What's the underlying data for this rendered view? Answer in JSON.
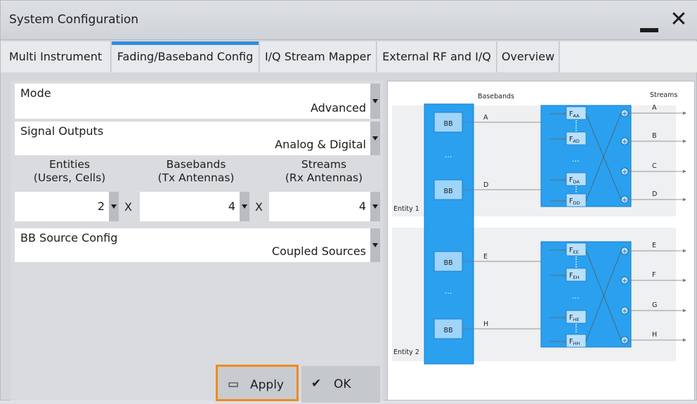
{
  "window": {
    "title": "System Configuration"
  },
  "tabs": [
    {
      "label": "Multi Instrument"
    },
    {
      "label": "Fading/Baseband Config"
    },
    {
      "label": "I/Q Stream Mapper"
    },
    {
      "label": "External RF and I/Q"
    },
    {
      "label": "Overview"
    }
  ],
  "form": {
    "mode": {
      "label": "Mode",
      "value": "Advanced"
    },
    "signal_outputs": {
      "label": "Signal Outputs",
      "value": "Analog & Digital"
    },
    "entities": {
      "label1": "Entities",
      "label2": "(Users, Cells)",
      "value": "2"
    },
    "basebands": {
      "label1": "Basebands",
      "label2": "(Tx Antennas)",
      "value": "4"
    },
    "streams": {
      "label1": "Streams",
      "label2": "(Rx Antennas)",
      "value": "4"
    },
    "x_symbol": "X",
    "bb_source": {
      "label": "BB Source Config",
      "value": "Coupled Sources"
    }
  },
  "buttons": {
    "apply": "Apply",
    "ok": "OK"
  },
  "diagram": {
    "basebands_label": "Basebands",
    "streams_label": "Streams",
    "bb_label": "BB",
    "ellipsis": "...",
    "entity1_label": "Entity 1",
    "entity2_label": "Entity 2",
    "entity1_bb": [
      "A",
      "D"
    ],
    "entity2_bb": [
      "E",
      "H"
    ],
    "entity1_streams": [
      "A",
      "B",
      "C",
      "D"
    ],
    "entity2_streams": [
      "E",
      "F",
      "G",
      "H"
    ],
    "entity1_faders": [
      {
        "base": "F",
        "sub": "AA"
      },
      {
        "base": "F",
        "sub": "AD"
      },
      {
        "base": "F",
        "sub": "DA"
      },
      {
        "base": "F",
        "sub": "DD"
      }
    ],
    "entity2_faders": [
      {
        "base": "F",
        "sub": "EE"
      },
      {
        "base": "F",
        "sub": "EH"
      },
      {
        "base": "F",
        "sub": "HE"
      },
      {
        "base": "F",
        "sub": "HH"
      }
    ],
    "sum_symbol": "+"
  },
  "colors": {
    "accent": "#2f8fdf",
    "focus": "#f08a1e",
    "block": "#2aa0ef"
  }
}
